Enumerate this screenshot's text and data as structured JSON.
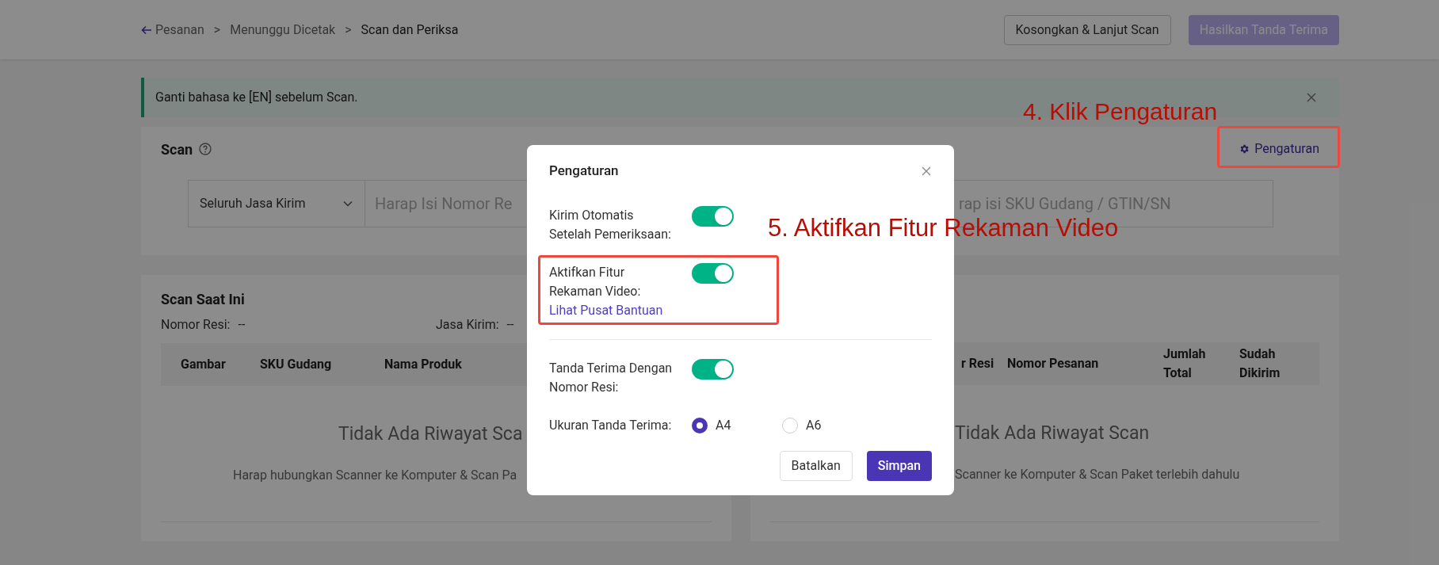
{
  "breadcrumb": [
    {
      "label": "Pesanan",
      "kind": "back",
      "current": false
    },
    {
      "label": "Menunggu Dicetak",
      "kind": "link",
      "current": false
    },
    {
      "label": "Scan dan Periksa",
      "kind": "link",
      "current": true
    }
  ],
  "breadcrumb_separator": ">",
  "header_buttons": [
    {
      "label": "Kosongkan & Lanjut Scan",
      "kind": "outline",
      "disabled": false
    },
    {
      "label": "Hasilkan Tanda Terima",
      "kind": "primary",
      "disabled": true
    }
  ],
  "alert": {
    "text": "Ganti bahasa ke [EN] sebelum Scan."
  },
  "scan": {
    "title": "Scan",
    "settings_link": "Pengaturan",
    "courier_select": "Seluruh Jasa Kirim",
    "resi_placeholder": "Harap Isi Nomor Re",
    "sku_placeholder": "rap isi SKU Gudang / GTIN/SN"
  },
  "current_scan": {
    "title": "Scan Saat Ini",
    "fields": [
      {
        "label": "Nomor Resi:",
        "value": "--"
      },
      {
        "label": "Jasa Kirim:",
        "value": "--"
      }
    ],
    "columns": [
      "Gambar",
      "SKU Gudang",
      "Nama Produk"
    ],
    "empty_title": "Tidak Ada Riwayat Sca",
    "empty_hint": "Harap hubungkan Scanner ke Komputer & Scan Pa"
  },
  "history": {
    "columns": [
      "r Resi",
      "Nomor Pesanan",
      "Jumlah Total",
      "Sudah Dikirim"
    ],
    "empty_title": "Tidak Ada Riwayat Scan",
    "empty_hint": "Scanner ke Komputer & Scan Paket terlebih dahulu"
  },
  "modal": {
    "title": "Pengaturan",
    "sections": [
      [
        {
          "kind": "toggle",
          "label": "Kirim Otomatis Setelah Pemeriksaan:",
          "on": true
        },
        {
          "kind": "toggle",
          "label": "Aktifkan Fitur Rekaman Video:",
          "on": true,
          "link": "Lihat Pusat Bantuan"
        }
      ],
      [
        {
          "kind": "toggle",
          "label": "Tanda Terima Dengan Nomor Resi:",
          "on": true
        },
        {
          "kind": "radio",
          "label": "Ukuran Tanda Terima:",
          "options": [
            {
              "label": "A4",
              "selected": true
            },
            {
              "label": "A6",
              "selected": false
            }
          ]
        }
      ]
    ],
    "buttons": [
      {
        "label": "Batalkan",
        "kind": "secondary"
      },
      {
        "label": "Simpan",
        "kind": "primary"
      }
    ]
  },
  "annotations": [
    {
      "text": "4. Klik Pengaturan"
    },
    {
      "text": "5. Aktifkan Fitur Rekaman Video"
    }
  ]
}
